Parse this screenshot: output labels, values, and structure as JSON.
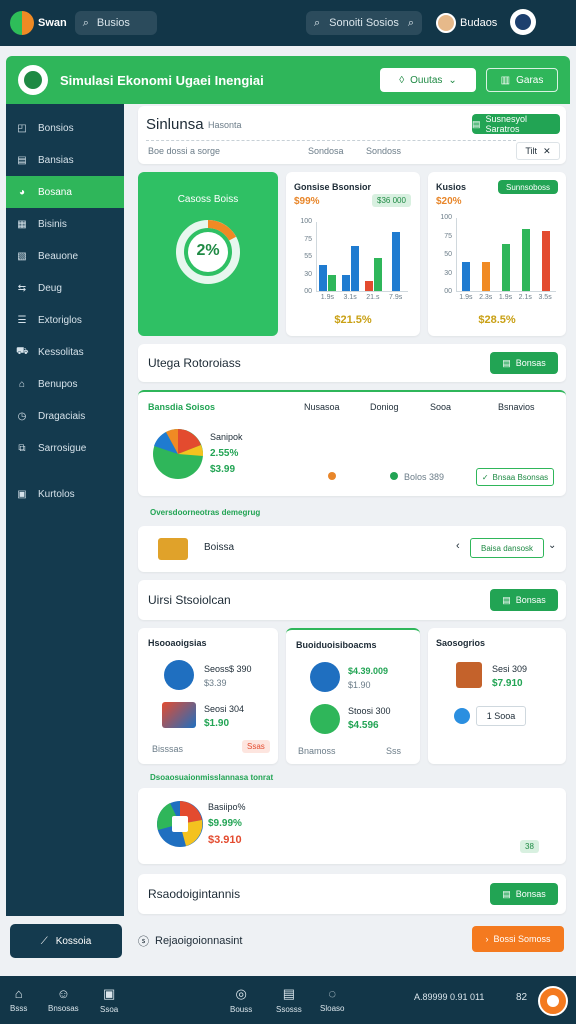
{
  "topbar": {
    "brand": "Swan",
    "search1": "Busios",
    "search2": "Sonoiti Sosios",
    "user": "Budaos"
  },
  "header": {
    "title": "Simulasi Ekonomi Ugaei Inengiai",
    "dropdown": "Ouutas",
    "button": "Garas"
  },
  "sidebar": {
    "items": [
      {
        "icon": "◰",
        "label": "Bonsios"
      },
      {
        "icon": "▤",
        "label": "Bansias"
      },
      {
        "icon": "◕",
        "label": "Bosana"
      },
      {
        "icon": "▦",
        "label": "Bisinis"
      },
      {
        "icon": "▧",
        "label": "Beauone"
      },
      {
        "icon": "⇆",
        "label": "Deug"
      },
      {
        "icon": "☰",
        "label": "Extoriglos"
      },
      {
        "icon": "⛟",
        "label": "Kessolitas"
      },
      {
        "icon": "⌂",
        "label": "Benupos"
      },
      {
        "icon": "◷",
        "label": "Dragaciais"
      },
      {
        "icon": "⧉",
        "label": "Sarrosigue"
      },
      {
        "icon": "▣",
        "label": "Kurtolos"
      }
    ],
    "bottom_button": "Kossoia"
  },
  "summary": {
    "title": "Sinlunsa",
    "subtitle": "Hasonta",
    "button": "Susnesyol Saratros",
    "filter_left": "Boe dossi a sorge",
    "filter_mid1": "Sondosa",
    "filter_mid2": "Sondoss",
    "filter_right": "Tilt"
  },
  "donut": {
    "label": "Casoss Boiss",
    "value": "2%"
  },
  "chart1": {
    "title": "Gonsise Bsonsior",
    "stat": "$99%",
    "tag": "$36 000",
    "footer": "$21.5%"
  },
  "chart2": {
    "title": "Kusios",
    "stat": "$20%",
    "tag": "Sunnsoboss",
    "footer": "$28.5%"
  },
  "chart_data": [
    {
      "type": "bar",
      "title": "Gonsise Bsonsior",
      "y_ticks": [
        "100",
        "75",
        "55",
        "30",
        "00"
      ],
      "x_ticks": [
        "1.9s",
        "3.1s",
        "21.s",
        "7.9s"
      ],
      "series": [
        {
          "values": [
            30,
            18,
            0,
            0
          ],
          "color": "#1f7bd0"
        },
        {
          "values": [
            18,
            0,
            0,
            0
          ],
          "color": "#2fb65a"
        },
        {
          "values": [
            0,
            0,
            12,
            0
          ],
          "color": "#e34b2f"
        },
        {
          "values": [
            0,
            52,
            0,
            0
          ],
          "color": "#1f7bd0"
        },
        {
          "values": [
            0,
            0,
            38,
            0
          ],
          "color": "#2fb65a"
        },
        {
          "values": [
            0,
            0,
            0,
            68
          ],
          "color": "#1f7bd0"
        }
      ]
    },
    {
      "type": "bar",
      "title": "Kusios",
      "y_ticks": [
        "100",
        "75",
        "50",
        "30",
        "00"
      ],
      "x_ticks": [
        "1.9s",
        "2.3s",
        "1.9s",
        "2.1s",
        "3.5s"
      ],
      "series": [
        {
          "values": [
            32,
            32,
            52,
            68,
            66
          ],
          "color": "#1f7bd0"
        }
      ]
    }
  ],
  "section1": {
    "title": "Utega Rotoroiass",
    "button": "Bonsas"
  },
  "table": {
    "headers": [
      "Bansdia Soisos",
      "Nusasoa",
      "Doniog",
      "Sooa",
      "Bsnavios"
    ],
    "pie_title": "Sanipok",
    "pie_value1": "2.55%",
    "pie_value2": "$3.99",
    "row_value": "Bolos 389",
    "row_button": "Bnsaa Bsonsas"
  },
  "subrow": {
    "label": "Boissa",
    "caption": "Oversdoorneotras demegrug",
    "button": "Baisa dansosk"
  },
  "section2": {
    "title": "Uirsi Stsoiolcan",
    "button": "Bonsas"
  },
  "cards": [
    {
      "title": "Hsooaoigsias",
      "item1_name": "Seoss$ 390",
      "item1_value": "$3.39",
      "item2_name": "Seosi 304",
      "item2_value": "$1.90",
      "footer": "Bisssas",
      "tag": "Ssas"
    },
    {
      "title": "Buoiduoisiboacms",
      "item1_name": "$4.39.009",
      "item1_value": "$1.90",
      "item2_name": "Stoosi 300",
      "item2_value": "$4.596",
      "footer": "Bnamoss",
      "tag": "Sss"
    },
    {
      "title": "Saosogrios",
      "item1_name": "Sesi 309",
      "item1_value": "$7.910",
      "input_value": "1 Sooa"
    }
  ],
  "panel2": {
    "header": "Dsoaosuaionmisslannasa tonrat",
    "pie_title": "Basiipo%",
    "value1": "$9.99%",
    "value2": "$3.910",
    "tag": "38"
  },
  "section3": {
    "title": "Rsaodoigintannis",
    "button": "Bonsas"
  },
  "bottom": {
    "caption": "Rejaoigoionnasint",
    "orange_button": "Bossi Somoss"
  },
  "nav": {
    "items": [
      "Bsss",
      "Bnsosas",
      "Ssoa",
      "Bouss",
      "Ssosss",
      "Sloaso"
    ],
    "status": "A.89999 0.91 011",
    "count": "82"
  }
}
